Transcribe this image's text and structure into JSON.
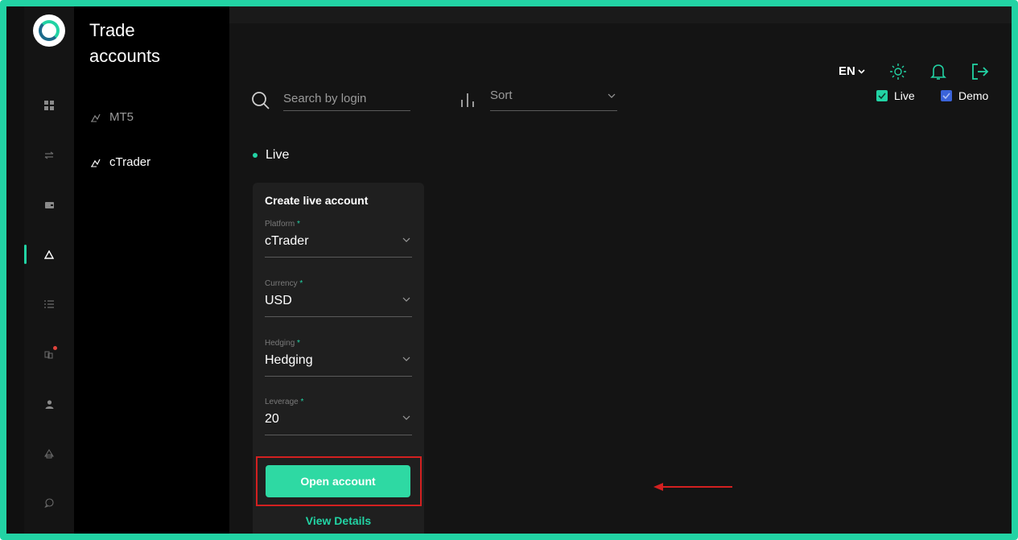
{
  "app": {
    "page_title": "Trade accounts"
  },
  "rail": {
    "items": [
      "dashboard-icon",
      "transfer-icon",
      "wallet-icon",
      "trade-accounts-icon",
      "list-icon",
      "partner-icon",
      "profile-icon",
      "security-icon",
      "chat-icon"
    ],
    "active": "trade-accounts-icon"
  },
  "sidepanel": {
    "items": [
      {
        "label": "MT5",
        "active": false
      },
      {
        "label": "cTrader",
        "active": true
      }
    ]
  },
  "toolbar": {
    "search_placeholder": "Search by login",
    "sort_label": "Sort"
  },
  "header": {
    "language": "EN",
    "filters": [
      {
        "label": "Live",
        "checked": true,
        "color": "#22d3a4"
      },
      {
        "label": "Demo",
        "checked": true,
        "color": "#3a63d9"
      }
    ]
  },
  "section": {
    "label": "Live"
  },
  "create_card": {
    "title": "Create live account",
    "fields": [
      {
        "label": "Platform",
        "value": "cTrader"
      },
      {
        "label": "Currency",
        "value": "USD"
      },
      {
        "label": "Hedging",
        "value": "Hedging"
      },
      {
        "label": "Leverage",
        "value": "20"
      }
    ],
    "required_marker": "*",
    "open_button": "Open account",
    "view_details": "View Details"
  },
  "colors": {
    "accent": "#22d3a4",
    "annotation": "#d32020",
    "demo": "#3a63d9"
  }
}
